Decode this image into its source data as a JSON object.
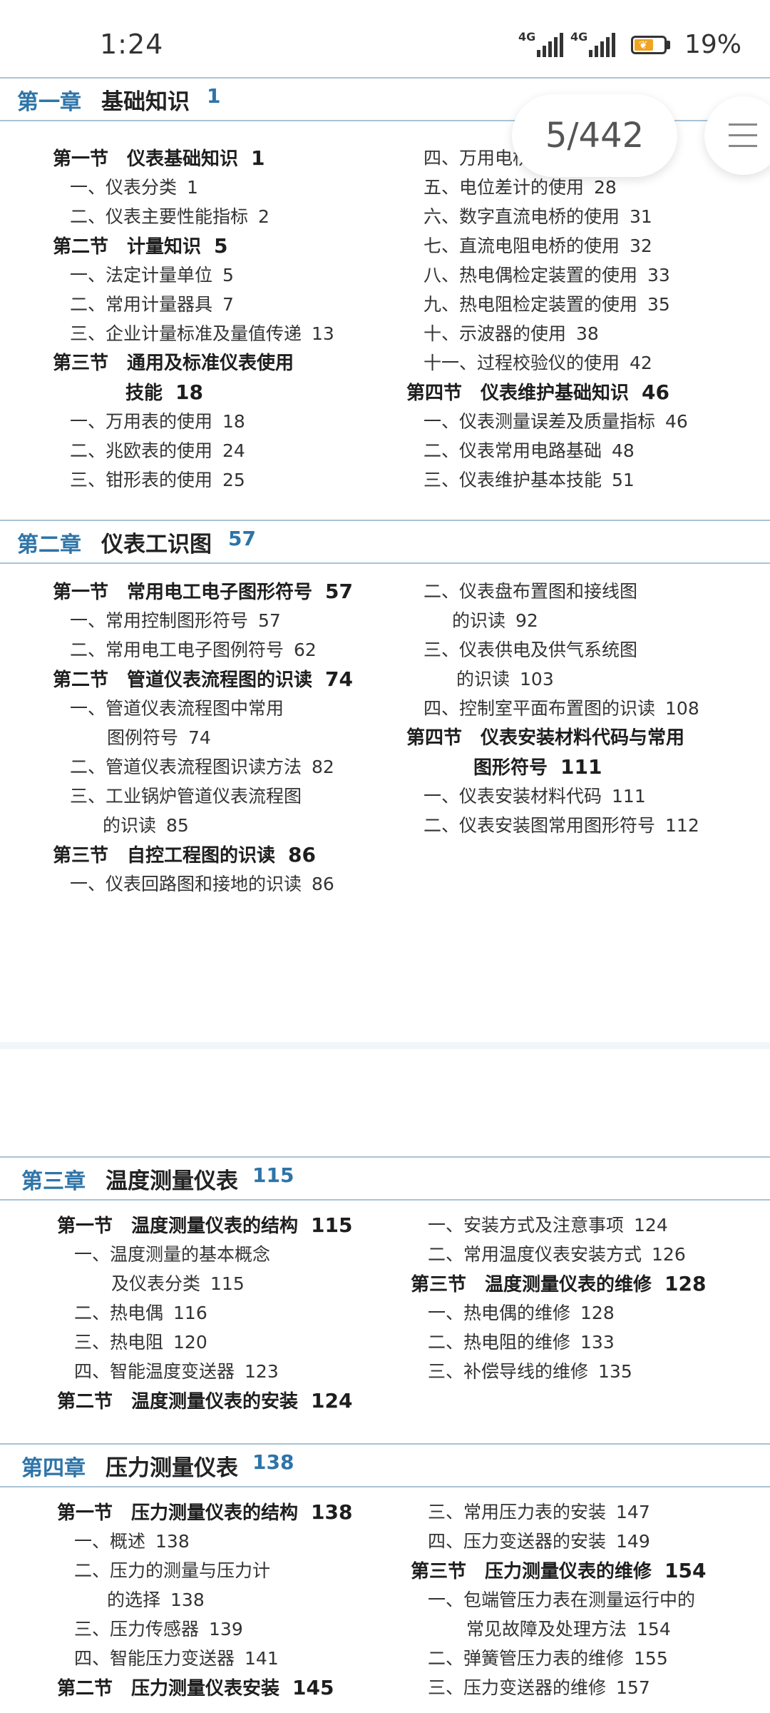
{
  "status": {
    "time": "1:24",
    "signal1": "4G",
    "signal2": "4G",
    "battery": "19%",
    "battery_level": 0.19
  },
  "reader": {
    "page_indicator": "5/442"
  },
  "toc": [
    {
      "chapter": "第一章",
      "title": "基础知识",
      "page": "1",
      "entries": [
        {
          "text": "第一节　仪表基础知识",
          "page": "1"
        },
        {
          "text": "一、仪表分类",
          "page": "1"
        },
        {
          "text": "二、仪表主要性能指标",
          "page": "2"
        },
        {
          "text": "第二节　计量知识",
          "page": "5"
        },
        {
          "text": "一、法定计量单位",
          "page": "5"
        },
        {
          "text": "二、常用计量器具",
          "page": "7"
        },
        {
          "text": "三、企业计量标准及量值传递",
          "page": "13"
        },
        {
          "text": "第三节　通用及标准仪表使用"
        },
        {
          "text": "技能",
          "page": "18"
        },
        {
          "text": "一、万用表的使用",
          "page": "18"
        },
        {
          "text": "二、兆欧表的使用",
          "page": "24"
        },
        {
          "text": "三、钳形表的使用",
          "page": "25"
        },
        {
          "text": "四、万用电桥"
        },
        {
          "text": "五、电位差计的使用",
          "page": "28"
        },
        {
          "text": "六、数字直流电桥的使用",
          "page": "31"
        },
        {
          "text": "七、直流电阻电桥的使用",
          "page": "32"
        },
        {
          "text": "八、热电偶检定装置的使用",
          "page": "33"
        },
        {
          "text": "九、热电阻检定装置的使用",
          "page": "35"
        },
        {
          "text": "十、示波器的使用",
          "page": "38"
        },
        {
          "text": "十一、过程校验仪的使用",
          "page": "42"
        },
        {
          "text": "第四节　仪表维护基础知识",
          "page": "46"
        },
        {
          "text": "一、仪表测量误差及质量指标",
          "page": "46"
        },
        {
          "text": "二、仪表常用电路基础",
          "page": "48"
        },
        {
          "text": "三、仪表维护基本技能",
          "page": "51"
        }
      ]
    },
    {
      "chapter": "第二章",
      "title": "仪表工识图",
      "page": "57",
      "entries": [
        {
          "text": "第一节　常用电工电子图形符号",
          "page": "57"
        },
        {
          "text": "一、常用控制图形符号",
          "page": "57"
        },
        {
          "text": "二、常用电工电子图例符号",
          "page": "62"
        },
        {
          "text": "第二节　管道仪表流程图的识读",
          "page": "74"
        },
        {
          "text": "一、管道仪表流程图中常用"
        },
        {
          "text": "图例符号",
          "page": "74"
        },
        {
          "text": "二、管道仪表流程图识读方法",
          "page": "82"
        },
        {
          "text": "三、工业锅炉管道仪表流程图"
        },
        {
          "text": "的识读",
          "page": "85"
        },
        {
          "text": "第三节　自控工程图的识读",
          "page": "86"
        },
        {
          "text": "一、仪表回路图和接地的识读",
          "page": "86"
        },
        {
          "text": "二、仪表盘布置图和接线图"
        },
        {
          "text": "的识读",
          "page": "92"
        },
        {
          "text": "三、仪表供电及供气系统图"
        },
        {
          "text": "的识读",
          "page": "103"
        },
        {
          "text": "四、控制室平面布置图的识读",
          "page": "108"
        },
        {
          "text": "第四节　仪表安装材料代码与常用"
        },
        {
          "text": "图形符号",
          "page": "111"
        },
        {
          "text": "一、仪表安装材料代码",
          "page": "111"
        },
        {
          "text": "二、仪表安装图常用图形符号",
          "page": "112"
        }
      ]
    },
    {
      "chapter": "第三章",
      "title": "温度测量仪表",
      "page": "115",
      "entries": [
        {
          "text": "第一节　温度测量仪表的结构",
          "page": "115"
        },
        {
          "text": "一、温度测量的基本概念"
        },
        {
          "text": "及仪表分类",
          "page": "115"
        },
        {
          "text": "二、热电偶",
          "page": "116"
        },
        {
          "text": "三、热电阻",
          "page": "120"
        },
        {
          "text": "四、智能温度变送器",
          "page": "123"
        },
        {
          "text": "第二节　温度测量仪表的安装",
          "page": "124"
        },
        {
          "text": "一、安装方式及注意事项",
          "page": "124"
        },
        {
          "text": "二、常用温度仪表安装方式",
          "page": "126"
        },
        {
          "text": "第三节　温度测量仪表的维修",
          "page": "128"
        },
        {
          "text": "一、热电偶的维修",
          "page": "128"
        },
        {
          "text": "二、热电阻的维修",
          "page": "133"
        },
        {
          "text": "三、补偿导线的维修",
          "page": "135"
        }
      ]
    },
    {
      "chapter": "第四章",
      "title": "压力测量仪表",
      "page": "138",
      "entries": [
        {
          "text": "第一节　压力测量仪表的结构",
          "page": "138"
        },
        {
          "text": "一、概述",
          "page": "138"
        },
        {
          "text": "二、压力的测量与压力计"
        },
        {
          "text": "的选择",
          "page": "138"
        },
        {
          "text": "三、压力传感器",
          "page": "139"
        },
        {
          "text": "四、智能压力变送器",
          "page": "141"
        },
        {
          "text": "第二节　压力测量仪表安装",
          "page": "145"
        },
        {
          "text": "三、常用压力表的安装",
          "page": "147"
        },
        {
          "text": "四、压力变送器的安装",
          "page": "149"
        },
        {
          "text": "第三节　压力测量仪表的维修",
          "page": "154"
        },
        {
          "text": "一、包端管压力表在测量运行中的"
        },
        {
          "text": "常见故障及处理方法",
          "page": "154"
        },
        {
          "text": "二、弹簧管压力表的维修",
          "page": "155"
        },
        {
          "text": "三、压力变送器的维修",
          "page": "157"
        }
      ]
    }
  ]
}
